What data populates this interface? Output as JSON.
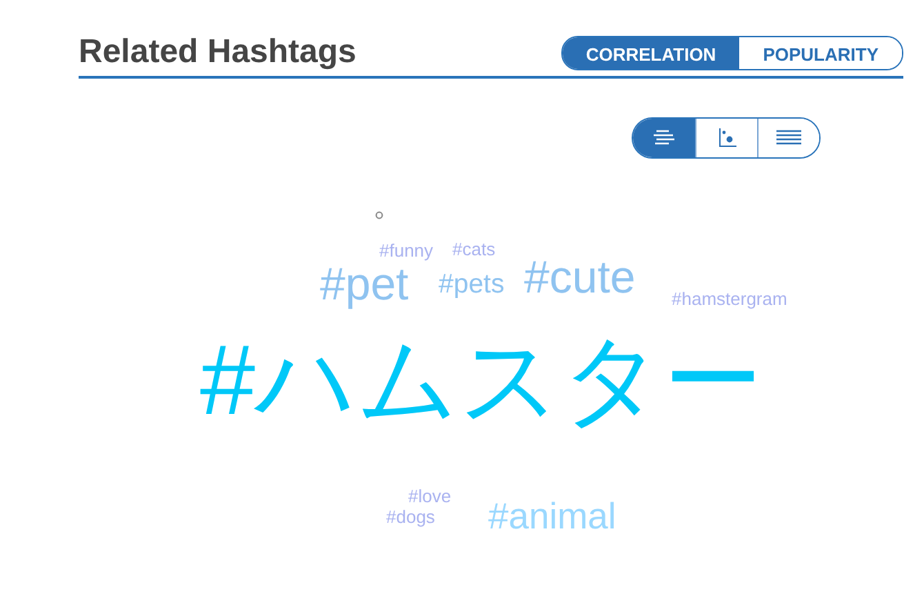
{
  "header": {
    "title": "Related Hashtags"
  },
  "tabs": [
    {
      "label": "CORRELATION",
      "selected": true
    },
    {
      "label": "POPULARITY",
      "selected": false
    }
  ],
  "views": [
    {
      "kind": "cloud",
      "selected": true
    },
    {
      "kind": "scatter",
      "selected": false
    },
    {
      "kind": "list",
      "selected": false
    }
  ],
  "cloud": [
    {
      "tag": "#funny",
      "color": "#a9b2f0"
    },
    {
      "tag": "#cats",
      "color": "#a9b2f0"
    },
    {
      "tag": "#pet",
      "color": "#8fc3f0"
    },
    {
      "tag": "#pets",
      "color": "#8fc3f0"
    },
    {
      "tag": "#cute",
      "color": "#8fc3f0"
    },
    {
      "tag": "#hamstergram",
      "color": "#a9b2f0"
    },
    {
      "tag": "#ハムスター",
      "color": "#00c8f8"
    },
    {
      "tag": "#love",
      "color": "#a9b2f0"
    },
    {
      "tag": "#dogs",
      "color": "#a9b2f0"
    },
    {
      "tag": "#animal",
      "color": "#9ad8ff"
    }
  ]
}
